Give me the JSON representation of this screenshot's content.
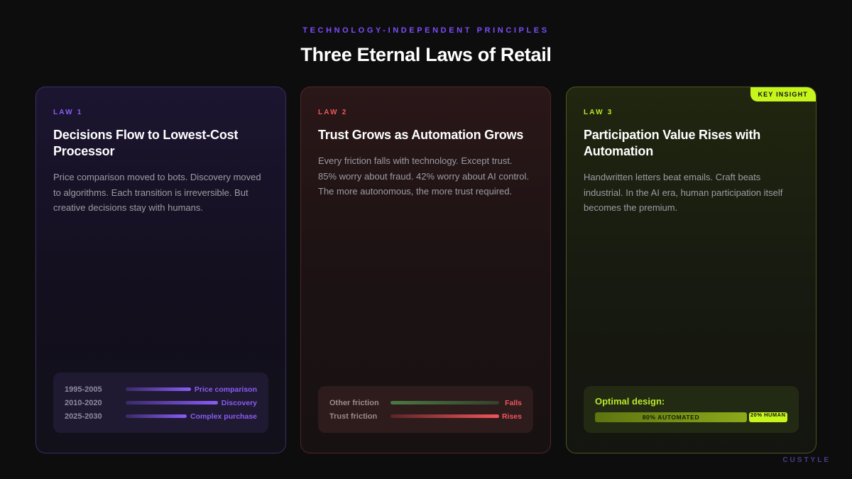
{
  "header": {
    "eyebrow": "TECHNOLOGY-INDEPENDENT PRINCIPLES",
    "title": "Three Eternal Laws of Retail"
  },
  "colors": {
    "background": "#0d0d0d",
    "purple_accent": "#8a5cf6",
    "red_accent": "#f0555b",
    "lime_accent": "#c6f51e"
  },
  "cards": [
    {
      "tag": "LAW 1",
      "title": "Decisions Flow to Lowest-Cost Processor",
      "body": "Price comparison moved to bots. Discovery moved to algorithms. Each transition is irreversible. But creative decisions stay with humans.",
      "timeline": [
        {
          "period": "1995-2005",
          "label": "Price comparison",
          "level": 0.85
        },
        {
          "period": "2010-2020",
          "label": "Discovery",
          "level": 1.0
        },
        {
          "period": "2025-2030",
          "label": "Complex purchase",
          "level": 0.75
        }
      ]
    },
    {
      "tag": "LAW 2",
      "title": "Trust Grows as Automation Grows",
      "body": "Every friction falls with technology. Except trust. 85% worry about fraud. 42% worry about AI control. The more autonomous, the more trust required.",
      "friction": [
        {
          "label": "Other friction",
          "trend": "Falls"
        },
        {
          "label": "Trust friction",
          "trend": "Rises"
        }
      ]
    },
    {
      "tag": "LAW 3",
      "title": "Participation Value Rises with Automation",
      "body": "Handwritten letters beat emails. Craft beats industrial. In the AI era, human participation itself becomes the premium.",
      "badge": "KEY INSIGHT",
      "optimal_label": "Optimal design:",
      "split": [
        {
          "label": "80% AUTOMATED",
          "percent": 80
        },
        {
          "label": "20% HUMAN",
          "percent": 20
        }
      ]
    }
  ],
  "watermark": "CUSTYLE"
}
